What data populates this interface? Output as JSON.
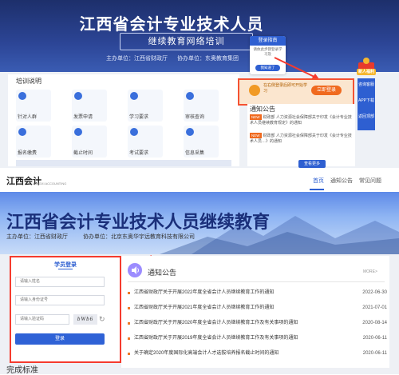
{
  "top": {
    "title": "江西省会计专业技术人员",
    "subtitle": "继续教育网络培训",
    "org_host": "主办单位：江西省财政厅",
    "org_partner": "协办单位：东奥教育集团",
    "login_guide": {
      "title": "登录指南",
      "body": "请依此步骤登录学习及",
      "button": "我知道了"
    },
    "badge": "新人福利",
    "section_label": "培训说明",
    "tiles": [
      "针对人群",
      "发票申请",
      "学习要求",
      "审核查询",
      "报名缴费",
      "截止时间",
      "考试要求",
      "信息采集"
    ],
    "login_box": {
      "text": "在右侧登录后即可开始学习",
      "button": "立即登录"
    },
    "notice": {
      "title": "通知公告",
      "items": [
        {
          "tag": "NEW",
          "text": "财政部 人力资源社会保障部关于印发《会计专业技术人员继续教育规定》的通知"
        },
        {
          "tag": "NEW",
          "text": "财政部 人力资源社会保障部关于印发《会计专业技术人员…》的通知"
        }
      ],
      "more": "查看更多"
    },
    "side_items": [
      "咨询客服",
      "APP下载",
      "返回顶部"
    ]
  },
  "bottom": {
    "logo": "江西会计",
    "logo_sub": "JIANGXI ACCOUNTING",
    "nav": [
      "首页",
      "通知公告",
      "常见问题"
    ],
    "hero_title": "江西省会计专业技术人员继续教育",
    "org_host": "主办单位：江西省财政厅",
    "org_partner": "协办单位：北京东奥华宇远教育科技有限公司",
    "login": {
      "title": "学员登录",
      "name_placeholder": "请输入姓名",
      "id_placeholder": "请输入身份证号",
      "captcha_placeholder": "请输入验证码",
      "captcha_text": "bWb6",
      "submit": "登录"
    },
    "notice": {
      "title": "通知公告",
      "more": "MORE>",
      "items": [
        {
          "text": "江西省财政厅关于开展2022年度全省会计人员继续教育工作的通知",
          "date": "2022-06-30"
        },
        {
          "text": "江西省财政厅关于开展2021年度全省会计人员继续教育工作的通知",
          "date": "2021-07-01"
        },
        {
          "text": "江西省财政厅关于开展2020年度全省会计人员继续教育工作及有关事项的通知",
          "date": "2020-08-14"
        },
        {
          "text": "江西省财政厅关于开展2019年度全省会计人员继续教育工作及有关事项的通知",
          "date": "2020-06-11"
        },
        {
          "text": "关于确定2020年度国际化高端会计人才选拔培养报名截止时间的通知",
          "date": "2020-06-11"
        }
      ]
    },
    "section2_title": "完成标准"
  },
  "colors": {
    "brand_blue": "#2e5fd1",
    "highlight_red": "#f53b2e",
    "orange": "#f06a1f"
  }
}
